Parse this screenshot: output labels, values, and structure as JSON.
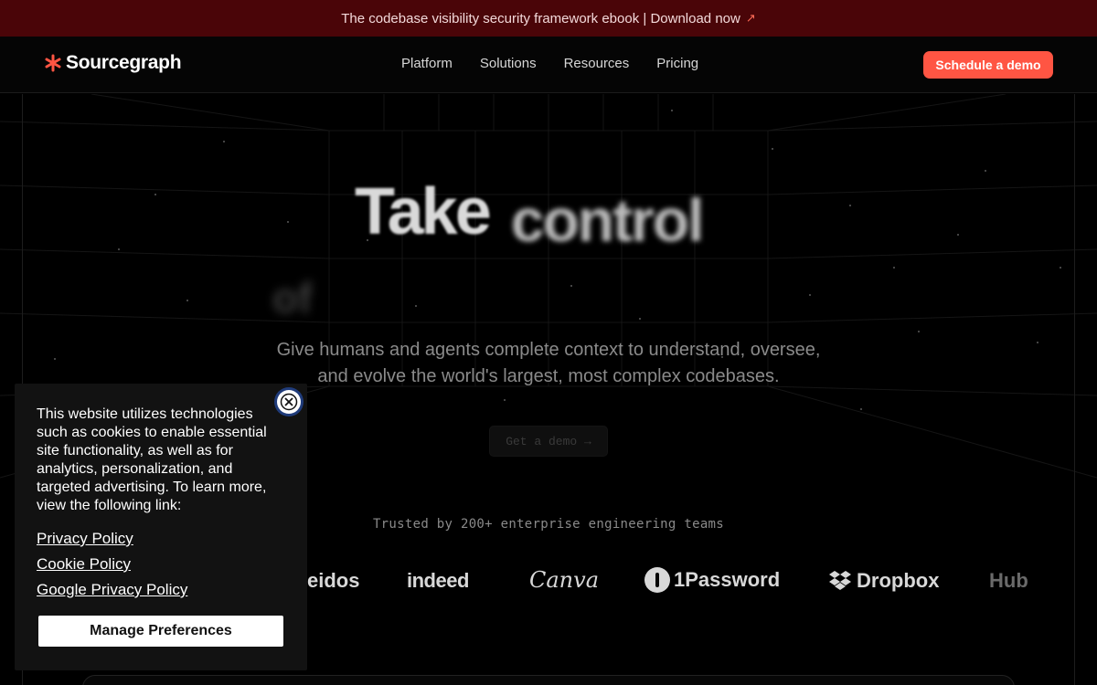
{
  "announcement": {
    "text": "The codebase visibility security framework ebook | Download now",
    "arrow": "↗"
  },
  "nav": {
    "brand": "Sourcegraph",
    "links": [
      "Platform",
      "Solutions",
      "Resources",
      "Pricing"
    ],
    "cta": "Schedule a demo"
  },
  "hero": {
    "headline_1": "Take",
    "headline_2": "control",
    "headline_3": "of",
    "subtitle_line1": "Give humans and agents complete context to understand, oversee,",
    "subtitle_line2": "and evolve the world's largest, most complex codebases.",
    "demo_button": "Get a demo →",
    "trusted": "Trusted by 200+ enterprise engineering teams"
  },
  "logos": [
    "eidos",
    "indeed",
    "Canva",
    "1Password",
    "Dropbox",
    "Hub"
  ],
  "cookie": {
    "text": "This website utilizes technologies such as cookies to enable essential site functionality, as well as for analytics, personalization, and targeted advertising. To learn more, view the following link:",
    "links": [
      "Privacy Policy",
      "Cookie Policy",
      "Google Privacy Policy"
    ],
    "manage_button": "Manage Preferences"
  },
  "colors": {
    "accent": "#ff5543",
    "announcement_bg": "#4a0508",
    "background": "#000000"
  }
}
